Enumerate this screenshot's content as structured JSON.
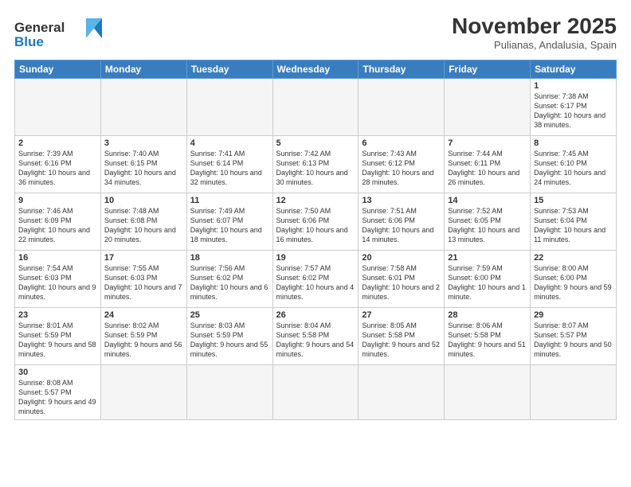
{
  "logo": {
    "text_general": "General",
    "text_blue": "Blue"
  },
  "title": "November 2025",
  "subtitle": "Pulianas, Andalusia, Spain",
  "weekdays": [
    "Sunday",
    "Monday",
    "Tuesday",
    "Wednesday",
    "Thursday",
    "Friday",
    "Saturday"
  ],
  "weeks": [
    [
      {
        "day": "",
        "info": ""
      },
      {
        "day": "",
        "info": ""
      },
      {
        "day": "",
        "info": ""
      },
      {
        "day": "",
        "info": ""
      },
      {
        "day": "",
        "info": ""
      },
      {
        "day": "",
        "info": ""
      },
      {
        "day": "1",
        "info": "Sunrise: 7:38 AM\nSunset: 6:17 PM\nDaylight: 10 hours and 38 minutes."
      }
    ],
    [
      {
        "day": "2",
        "info": "Sunrise: 7:39 AM\nSunset: 6:16 PM\nDaylight: 10 hours and 36 minutes."
      },
      {
        "day": "3",
        "info": "Sunrise: 7:40 AM\nSunset: 6:15 PM\nDaylight: 10 hours and 34 minutes."
      },
      {
        "day": "4",
        "info": "Sunrise: 7:41 AM\nSunset: 6:14 PM\nDaylight: 10 hours and 32 minutes."
      },
      {
        "day": "5",
        "info": "Sunrise: 7:42 AM\nSunset: 6:13 PM\nDaylight: 10 hours and 30 minutes."
      },
      {
        "day": "6",
        "info": "Sunrise: 7:43 AM\nSunset: 6:12 PM\nDaylight: 10 hours and 28 minutes."
      },
      {
        "day": "7",
        "info": "Sunrise: 7:44 AM\nSunset: 6:11 PM\nDaylight: 10 hours and 26 minutes."
      },
      {
        "day": "8",
        "info": "Sunrise: 7:45 AM\nSunset: 6:10 PM\nDaylight: 10 hours and 24 minutes."
      }
    ],
    [
      {
        "day": "9",
        "info": "Sunrise: 7:46 AM\nSunset: 6:09 PM\nDaylight: 10 hours and 22 minutes."
      },
      {
        "day": "10",
        "info": "Sunrise: 7:48 AM\nSunset: 6:08 PM\nDaylight: 10 hours and 20 minutes."
      },
      {
        "day": "11",
        "info": "Sunrise: 7:49 AM\nSunset: 6:07 PM\nDaylight: 10 hours and 18 minutes."
      },
      {
        "day": "12",
        "info": "Sunrise: 7:50 AM\nSunset: 6:06 PM\nDaylight: 10 hours and 16 minutes."
      },
      {
        "day": "13",
        "info": "Sunrise: 7:51 AM\nSunset: 6:06 PM\nDaylight: 10 hours and 14 minutes."
      },
      {
        "day": "14",
        "info": "Sunrise: 7:52 AM\nSunset: 6:05 PM\nDaylight: 10 hours and 13 minutes."
      },
      {
        "day": "15",
        "info": "Sunrise: 7:53 AM\nSunset: 6:04 PM\nDaylight: 10 hours and 11 minutes."
      }
    ],
    [
      {
        "day": "16",
        "info": "Sunrise: 7:54 AM\nSunset: 6:03 PM\nDaylight: 10 hours and 9 minutes."
      },
      {
        "day": "17",
        "info": "Sunrise: 7:55 AM\nSunset: 6:03 PM\nDaylight: 10 hours and 7 minutes."
      },
      {
        "day": "18",
        "info": "Sunrise: 7:56 AM\nSunset: 6:02 PM\nDaylight: 10 hours and 6 minutes."
      },
      {
        "day": "19",
        "info": "Sunrise: 7:57 AM\nSunset: 6:02 PM\nDaylight: 10 hours and 4 minutes."
      },
      {
        "day": "20",
        "info": "Sunrise: 7:58 AM\nSunset: 6:01 PM\nDaylight: 10 hours and 2 minutes."
      },
      {
        "day": "21",
        "info": "Sunrise: 7:59 AM\nSunset: 6:00 PM\nDaylight: 10 hours and 1 minute."
      },
      {
        "day": "22",
        "info": "Sunrise: 8:00 AM\nSunset: 6:00 PM\nDaylight: 9 hours and 59 minutes."
      }
    ],
    [
      {
        "day": "23",
        "info": "Sunrise: 8:01 AM\nSunset: 5:59 PM\nDaylight: 9 hours and 58 minutes."
      },
      {
        "day": "24",
        "info": "Sunrise: 8:02 AM\nSunset: 5:59 PM\nDaylight: 9 hours and 56 minutes."
      },
      {
        "day": "25",
        "info": "Sunrise: 8:03 AM\nSunset: 5:59 PM\nDaylight: 9 hours and 55 minutes."
      },
      {
        "day": "26",
        "info": "Sunrise: 8:04 AM\nSunset: 5:58 PM\nDaylight: 9 hours and 54 minutes."
      },
      {
        "day": "27",
        "info": "Sunrise: 8:05 AM\nSunset: 5:58 PM\nDaylight: 9 hours and 52 minutes."
      },
      {
        "day": "28",
        "info": "Sunrise: 8:06 AM\nSunset: 5:58 PM\nDaylight: 9 hours and 51 minutes."
      },
      {
        "day": "29",
        "info": "Sunrise: 8:07 AM\nSunset: 5:57 PM\nDaylight: 9 hours and 50 minutes."
      }
    ],
    [
      {
        "day": "30",
        "info": "Sunrise: 8:08 AM\nSunset: 5:57 PM\nDaylight: 9 hours and 49 minutes."
      },
      {
        "day": "",
        "info": ""
      },
      {
        "day": "",
        "info": ""
      },
      {
        "day": "",
        "info": ""
      },
      {
        "day": "",
        "info": ""
      },
      {
        "day": "",
        "info": ""
      },
      {
        "day": "",
        "info": ""
      }
    ]
  ]
}
